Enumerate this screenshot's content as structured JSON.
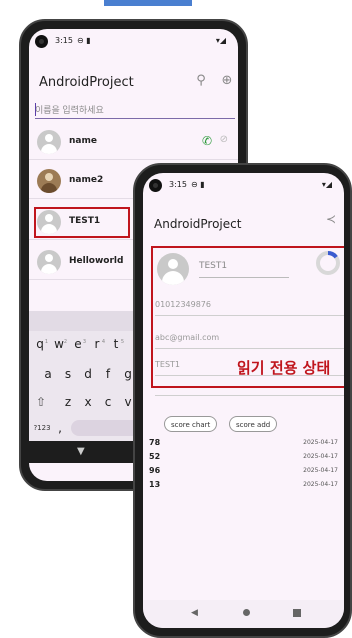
{
  "phone1": {
    "status_time": "3:15",
    "status_icons": "⊖ ▮",
    "status_right": "▾◢",
    "app_title": "AndroidProject",
    "search_placeholder": "이름을 입력하세요",
    "contacts": [
      {
        "name": "name"
      },
      {
        "name": "name2"
      },
      {
        "name": "TEST1"
      },
      {
        "name": "Helloworld"
      }
    ],
    "keyboard": {
      "row1": [
        "q",
        "w",
        "e",
        "r",
        "t"
      ],
      "row1_sup": [
        "1",
        "2",
        "3",
        "4",
        "5"
      ],
      "row2": [
        "a",
        "s",
        "d",
        "f",
        "g"
      ],
      "row3": [
        "z",
        "x",
        "c",
        "v"
      ],
      "numkey": "?123",
      "comma": ","
    }
  },
  "phone2": {
    "status_time": "3:15",
    "status_icons": "⊖ ▮",
    "status_right": "▾◢",
    "app_title": "AndroidProject",
    "detail": {
      "name": "TEST1",
      "phone": "01012349876",
      "email": "abc@gmail.com",
      "memo": "TEST1",
      "progress": 0.15
    },
    "readonly_label": "읽기 전용 상태",
    "buttons": {
      "score_chart": "score chart",
      "score_add": "score add"
    },
    "scores": [
      {
        "value": "78",
        "date": "2025-04-17"
      },
      {
        "value": "52",
        "date": "2025-04-17"
      },
      {
        "value": "96",
        "date": "2025-04-17"
      },
      {
        "value": "13",
        "date": "2025-04-17"
      }
    ]
  },
  "colors": {
    "highlight": "#c0151d",
    "call": "#2b9a3a",
    "accent": "#3a5bd0"
  }
}
